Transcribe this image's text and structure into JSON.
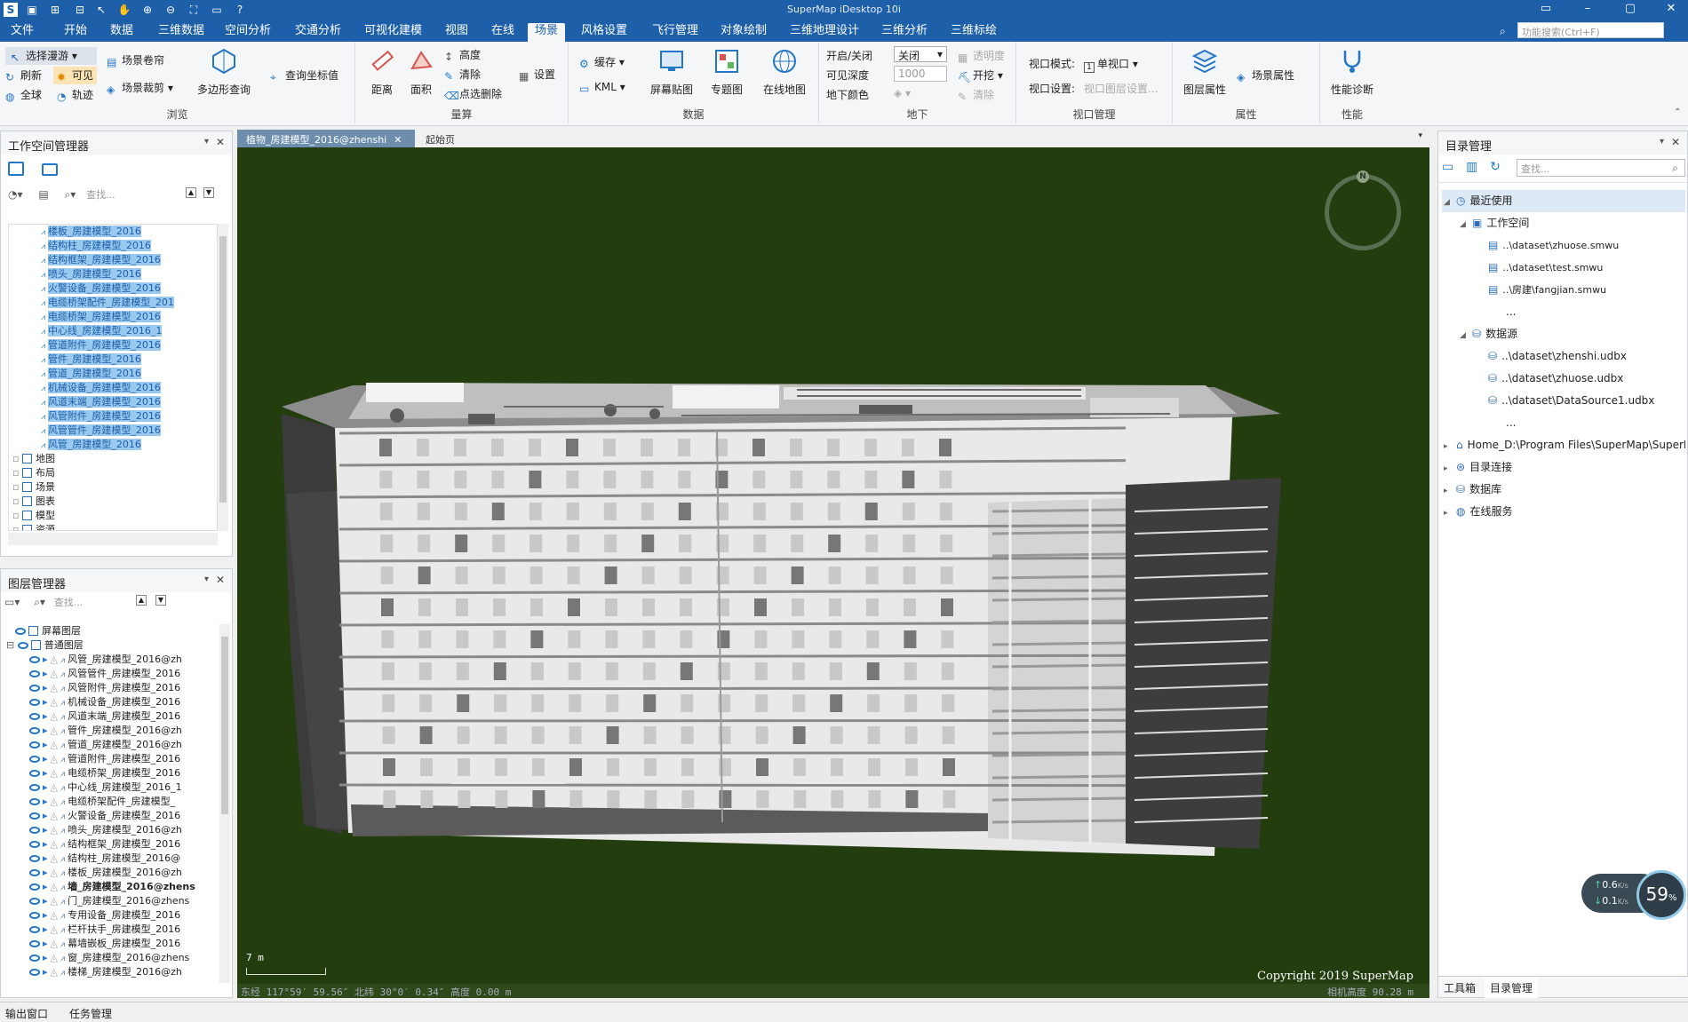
{
  "app": {
    "title": "SuperMap iDesktop 10i"
  },
  "menu": [
    "文件",
    "开始",
    "数据",
    "三维数据",
    "空间分析",
    "交通分析",
    "可视化建模",
    "视图",
    "在线",
    "场景",
    "风格设置",
    "飞行管理",
    "对象绘制",
    "三维地理设计",
    "三维分析",
    "三维标绘"
  ],
  "menu_active": "场景",
  "function_search": {
    "placeholder": "功能搜索(Ctrl+F)"
  },
  "ribbon": {
    "browse": {
      "label": "浏览",
      "select": "选择漫游",
      "refresh": "刷新",
      "visible": "可见",
      "globe": "全球",
      "track": "轨迹",
      "roller": "场景卷帘",
      "clip": "场景裁剪",
      "polygon_query": "多边形查询",
      "query_coord": "查询坐标值"
    },
    "measure": {
      "label": "量算",
      "distance": "距离",
      "area": "面积",
      "height": "高度",
      "clear": "清除",
      "pick_delete": "点选删除",
      "settings": "设置"
    },
    "data": {
      "label": "数据",
      "cache": "缓存",
      "kml": "KML",
      "screen_paste": "屏幕贴图",
      "thematic": "专题图",
      "online_map": "在线地图"
    },
    "underground": {
      "label": "地下",
      "toggle": "开启/关闭",
      "toggle_val": "关闭",
      "visible_depth": "可见深度",
      "depth_val": "1000",
      "ground_color": "地下颜色",
      "transparency": "透明度",
      "excavate": "开挖",
      "clear": "清除"
    },
    "viewport": {
      "label": "视口管理",
      "mode": "视口模式:",
      "mode_val": "单视口",
      "settings": "视口设置:",
      "settings_val": "视口图层设置..."
    },
    "properties": {
      "label": "属性",
      "layer_props": "图层属性",
      "scene_props": "场景属性"
    },
    "perf": {
      "label": "性能",
      "diag": "性能诊断"
    }
  },
  "workspace_panel": {
    "title": "工作空间管理器",
    "search_placeholder": "查找...",
    "selected_items": [
      "楼板_房建模型_2016",
      "结构柱_房建模型_2016",
      "结构框架_房建模型_2016",
      "喷头_房建模型_2016",
      "火警设备_房建模型_2016",
      "电缆桥架配件_房建模型_201",
      "电缆桥架_房建模型_2016",
      "中心线_房建模型_2016_1",
      "管道附件_房建模型_2016",
      "管件_房建模型_2016",
      "管道_房建模型_2016",
      "机械设备_房建模型_2016",
      "风道末端_房建模型_2016",
      "风管附件_房建模型_2016",
      "风管管件_房建模型_2016",
      "风管_房建模型_2016"
    ],
    "nodes": [
      "地图",
      "布局",
      "场景",
      "图表",
      "模型",
      "资源"
    ]
  },
  "layer_panel": {
    "title": "图层管理器",
    "search_placeholder": "查找...",
    "screen_layer": "屏幕图层",
    "normal_layer": "普通图层",
    "layers": [
      "风管_房建模型_2016@zh",
      "风管管件_房建模型_2016",
      "风管附件_房建模型_2016",
      "机械设备_房建模型_2016",
      "风道末端_房建模型_2016",
      "管件_房建模型_2016@zh",
      "管道_房建模型_2016@zh",
      "管道附件_房建模型_2016",
      "电缆桥架_房建模型_2016",
      "中心线_房建模型_2016_1",
      "电缆桥架配件_房建模型_",
      "火警设备_房建模型_2016",
      "喷头_房建模型_2016@zh",
      "结构框架_房建模型_2016",
      "结构柱_房建模型_2016@",
      "楼板_房建模型_2016@zh",
      "墙_房建模型_2016@zhens",
      "门_房建模型_2016@zhens",
      "专用设备_房建模型_2016",
      "栏杆扶手_房建模型_2016",
      "幕墙嵌板_房建模型_2016",
      "窗_房建模型_2016@zhens",
      "楼梯_房建模型_2016@zh"
    ],
    "bold_layer": "墙_房建模型_2016@zhens"
  },
  "doc_tabs": {
    "active": "植物_房建模型_2016@zhenshi",
    "other": "起始页"
  },
  "viewport": {
    "compass": "N",
    "scale": "7 m",
    "copyright": "Copyright 2019 SuperMap",
    "coords": "东经 117°59′ 59.56″   北纬 30°0′ 0.34″   高度 0.00 m",
    "camera": "相机高度 90.28 m"
  },
  "catalog": {
    "title": "目录管理",
    "search_placeholder": "查找...",
    "recent": "最近使用",
    "workspace": "工作空间",
    "ws_files": [
      "..\\dataset\\zhuose.smwu",
      "..\\dataset\\test.smwu",
      "..\\房建\\fangjian.smwu"
    ],
    "ellipsis": "...",
    "datasource": "数据源",
    "ds_files": [
      "..\\dataset\\zhenshi.udbx",
      "..\\dataset\\zhuose.udbx",
      "..\\dataset\\DataSource1.udbx"
    ],
    "home": "Home_D:\\Program Files\\SuperMap\\SuperM...",
    "dir_conn": "目录连接",
    "database": "数据库",
    "online_service": "在线服务",
    "bottom_tabs": [
      "工具箱",
      "目录管理"
    ]
  },
  "net": {
    "up": "0.6",
    "down": "0.1",
    "unit": "K/s",
    "pct": "59",
    "pct_unit": "%"
  },
  "status": {
    "output": "输出窗口",
    "task": "任务管理"
  }
}
